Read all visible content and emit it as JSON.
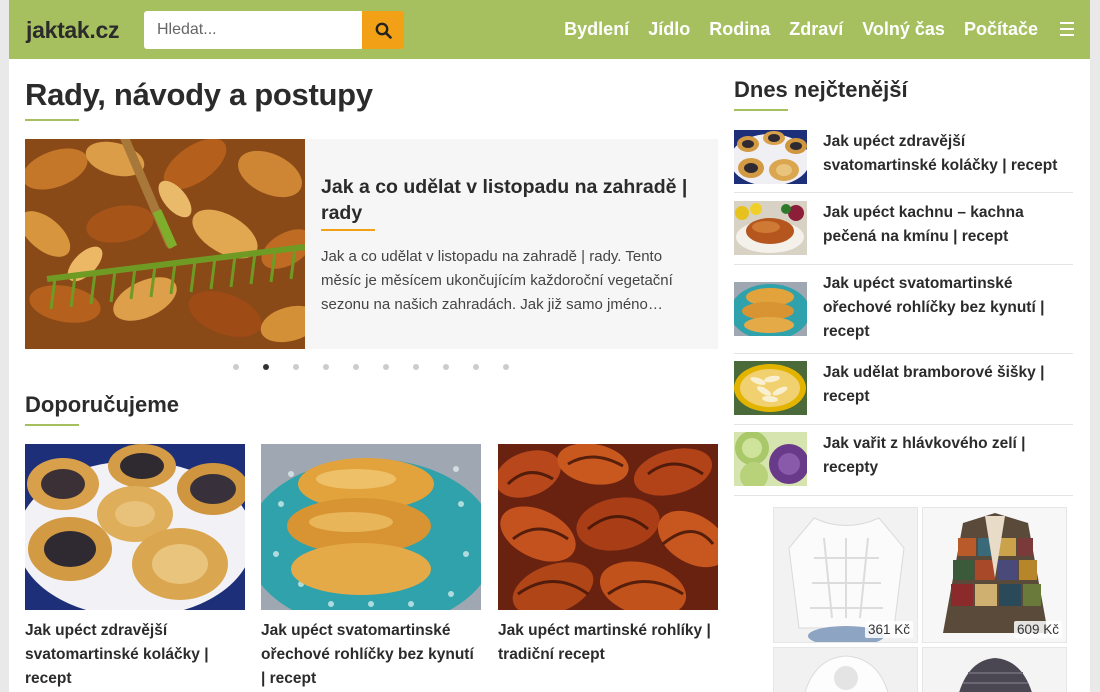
{
  "header": {
    "logo": "jaktak.cz",
    "search_placeholder": "Hledat...",
    "nav": [
      "Bydlení",
      "Jídlo",
      "Rodina",
      "Zdraví",
      "Volný čas",
      "Počítače"
    ]
  },
  "main": {
    "heading": "Rady, návody a postupy",
    "featured": {
      "title": "Jak a co udělat v listopadu na zahradě | rady",
      "excerpt": "Jak a co udělat v listopadu na zahradě | rady. Tento měsíc je měsícem ukončujícím každoroční vegetační sezonu na našich zahradách. Jak již samo jméno…"
    },
    "slider": {
      "total": 10,
      "active_index": 1
    },
    "recommended_heading": "Doporučujeme",
    "cards": [
      "Jak upéct zdravější svatomartinské koláčky | recept",
      "Jak upéct svatomartinské ořechové rohlíčky bez kynutí | recept",
      "Jak upéct martinské rohlíky | tradiční recept"
    ]
  },
  "sidebar": {
    "heading": "Dnes nejčtenější",
    "items": [
      "Jak upéct zdravější svatomartinské koláčky | recept",
      "Jak upéct kachnu – kachna pečená na kmínu | recept",
      "Jak upéct svatomartinské ořechové rohlíčky bez kynutí | recept",
      "Jak udělat bramborové šišky | recept",
      "Jak vařit z hlávkového zelí | recepty"
    ]
  },
  "ad": {
    "prices": [
      "361 Kč",
      "609 Kč"
    ]
  },
  "colors": {
    "brand_green": "#a6c05f",
    "accent_orange": "#f2a116"
  }
}
